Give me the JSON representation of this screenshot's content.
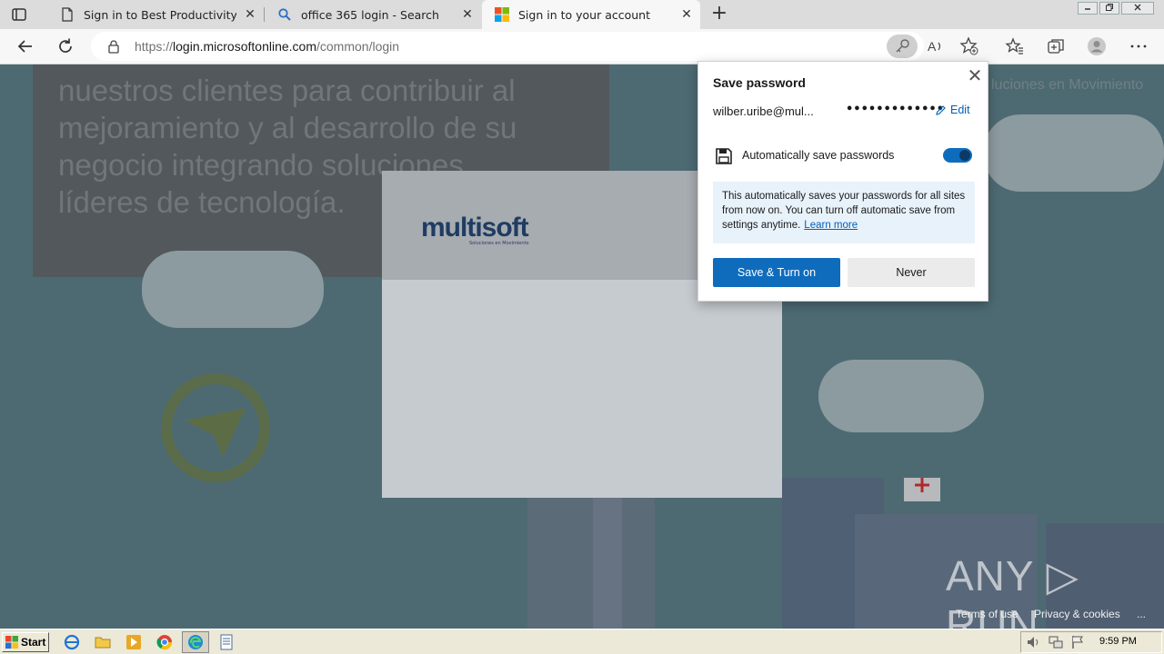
{
  "browser": {
    "tabs": [
      {
        "title": "Sign in to Best Productivity Pro",
        "icon": "page-icon",
        "active": false
      },
      {
        "title": "office 365 login - Search",
        "icon": "search-icon",
        "active": false
      },
      {
        "title": "Sign in to your account",
        "icon": "microsoft-icon",
        "active": true
      }
    ],
    "close_glyph": "✕",
    "new_tab_glyph": "+",
    "url_prefix": "https://",
    "url_host": "login.microsoftonline.com",
    "url_path": "/common/login"
  },
  "page": {
    "banner_lines": [
      "nuestros clientes para contribuir al",
      "mejoramiento y al desarrollo de su",
      "negocio integrando soluciones",
      "líderes de tecnología."
    ],
    "brand_right": "luciones en Movimiento",
    "logo_text": "multisoft",
    "logo_sub": "Soluciones en Movimiento",
    "footer_terms": "Terms of use",
    "footer_privacy": "Privacy & cookies",
    "footer_more": "...",
    "watermark": "ANY ▷ RUN"
  },
  "popup": {
    "title": "Save password",
    "close_glyph": "✕",
    "username": "wilber.uribe@mul...",
    "password_mask": "•••••••••••••",
    "edit_label": "Edit",
    "toggle_label": "Automatically save passwords",
    "toggle_on": true,
    "info_text": "This automatically saves your passwords for all sites from now on. You can turn off automatic save from settings anytime.",
    "learn_more": "Learn more",
    "save_button": "Save & Turn on",
    "never_button": "Never"
  },
  "taskbar": {
    "start_label": "Start",
    "time": "9:59 PM"
  },
  "colors": {
    "accent": "#0f6cbd",
    "link": "#005fb8",
    "info_bg": "#e8f2fb"
  }
}
